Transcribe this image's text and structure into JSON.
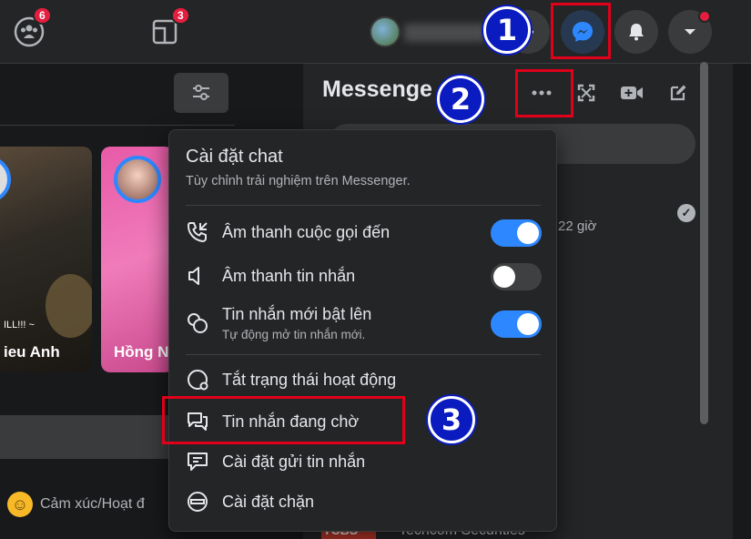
{
  "topbar": {
    "friends_badge": "6",
    "pages_badge": "3"
  },
  "left": {
    "stories": [
      {
        "name": "ieu Anh",
        "caption": "ILL!!! ~"
      },
      {
        "name": "Hồng N"
      }
    ],
    "feeling_label": "Cảm xúc/Hoạt đ"
  },
  "messenger": {
    "title": "Messenger",
    "time_text": "22 giờ",
    "bottom_sender_logo": "TCBS",
    "bottom_text": "Techcom Securities"
  },
  "chat_settings": {
    "title": "Cài đặt chat",
    "subtitle": "Tùy chỉnh trải nghiệm trên Messenger.",
    "toggles": [
      {
        "label": "Âm thanh cuộc gọi đến",
        "on": true
      },
      {
        "label": "Âm thanh tin nhắn",
        "on": false
      },
      {
        "label": "Tin nhắn mới bật lên",
        "note": "Tự động mở tin nhắn mới.",
        "on": true
      }
    ],
    "items": [
      {
        "label": "Tắt trạng thái hoạt động"
      },
      {
        "label": "Tin nhắn đang chờ"
      },
      {
        "label": "Cài đặt gửi tin nhắn"
      },
      {
        "label": "Cài đặt chặn"
      }
    ]
  },
  "annotations": {
    "marker_1": "1",
    "marker_2": "2",
    "marker_3": "3"
  },
  "colors": {
    "accent": "#2d88ff",
    "highlight": "#e0001a",
    "marker": "#0a1bbf"
  }
}
